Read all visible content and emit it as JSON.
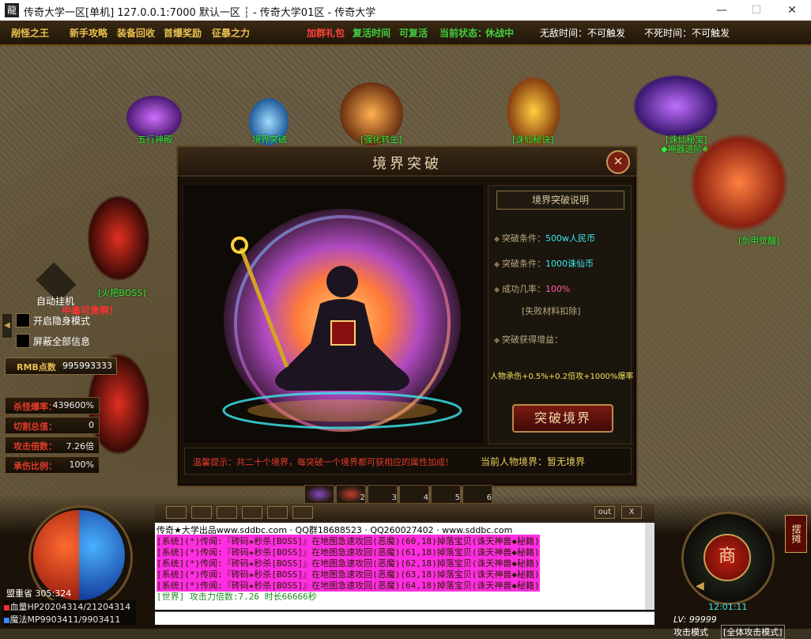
{
  "window": {
    "title": "传奇大学一区[单机] 127.0.0.1:7000  默认一区 ┆ - 传奇大学01区 - 传奇大学",
    "min": "—",
    "max": "☐",
    "close": "✕"
  },
  "topbar": {
    "items": [
      "剐怪之王",
      "新手攻略",
      "装备回收",
      "首爆奖励",
      "征暴之力"
    ],
    "mid": [
      "加群礼包",
      "复活时间",
      "可复活",
      "当前状态：",
      "休战中"
    ],
    "right": [
      "无敌时间：不可触发",
      "不死时间：不可触发"
    ]
  },
  "npcs": [
    "五行神殿",
    "境界突破",
    "[强化转生]",
    "[诛仙秘诀]",
    "[诛仙秘宝]",
    "◆神器进阶◆",
    "[剑甲觉醒]"
  ],
  "dialog": {
    "title": "境界突破",
    "close": "✕",
    "panel_header": "境界突破说明",
    "cond1_label": "突破条件：",
    "cond1_value": "500w人民币",
    "cond2_label": "突破条件：",
    "cond2_value": "1000诛仙币",
    "rate_label": "成功几率：",
    "rate_value": "100%",
    "fail_note": "[失败材料扣除]",
    "gain_label": "突破获得增益：",
    "gain_value": "人物承伤+0.5%+0.2倍攻+1000%爆率",
    "break_button": "突破境界",
    "tip": "温馨提示：共二十个境界，每突破一个境界都可获相应的属性加成！",
    "current": "当前人物境界：暂无境界"
  },
  "left": {
    "auto": "自动挂机",
    "boss_note": "[火把BOSS]",
    "boss_sub": "中毒可贵啊！",
    "opt1": "开启隐身模式",
    "opt2": "屏蔽全部信息",
    "rmb_label": "RMB点数",
    "rmb_value": "995993333",
    "stats": [
      {
        "k": "杀怪爆率：",
        "v": "439600%"
      },
      {
        "k": "切割总值：",
        "v": "0"
      },
      {
        "k": "攻击倍数：",
        "v": "7.26倍"
      },
      {
        "k": "承伤比例：",
        "v": "100%"
      }
    ],
    "map": "盟重省 305:324",
    "hp": "血量HP20204314/21204314",
    "mp": "魔法MP9903411/9903411"
  },
  "skills": [
    "2",
    "3",
    "4",
    "5",
    "6"
  ],
  "chat": {
    "tools_out": "out",
    "tools_x": "X",
    "header": "传奇★大学出品www.sddbc.com · QQ群18688523 · QQ260027402 · www.sddbc.com",
    "lines": [
      "[系统](*)传闻:『砖码★秒杀[BOSS]』在地图急速攻回(恶魔)(60,18)掉落宝贝(诛天神兽◆秘籍)",
      "[系统](*)传闻:『砖码★秒杀[BOSS]』在地图急速攻回(恶魔)(61,18)掉落宝贝(诛天神兽◆秘籍)",
      "[系统](*)传闻:『砖码★秒杀[BOSS]』在地图急速攻回(恶魔)(62,18)掉落宝贝(诛天神兽◆秘籍)",
      "[系统](*)传闻:『砖码★秒杀[BOSS]』在地图急速攻回(恶魔)(63,18)掉落宝贝(诛天神兽◆秘籍)",
      "[系统](*)传闻:『砖码★秒杀[BOSS]』在地图急速攻回(恶魔)(64,18)掉落宝贝(诛天神兽◆秘籍)"
    ],
    "world": "[世界] 攻击力倍数:7.26 时长66666秒"
  },
  "right": {
    "shop": "商",
    "shop_side": "摆摊",
    "time": "12:01:11",
    "lv_label": "LV:",
    "lv_value": "99999",
    "mode_label": "攻击模式",
    "mode_value": "[全体攻击模式]"
  }
}
